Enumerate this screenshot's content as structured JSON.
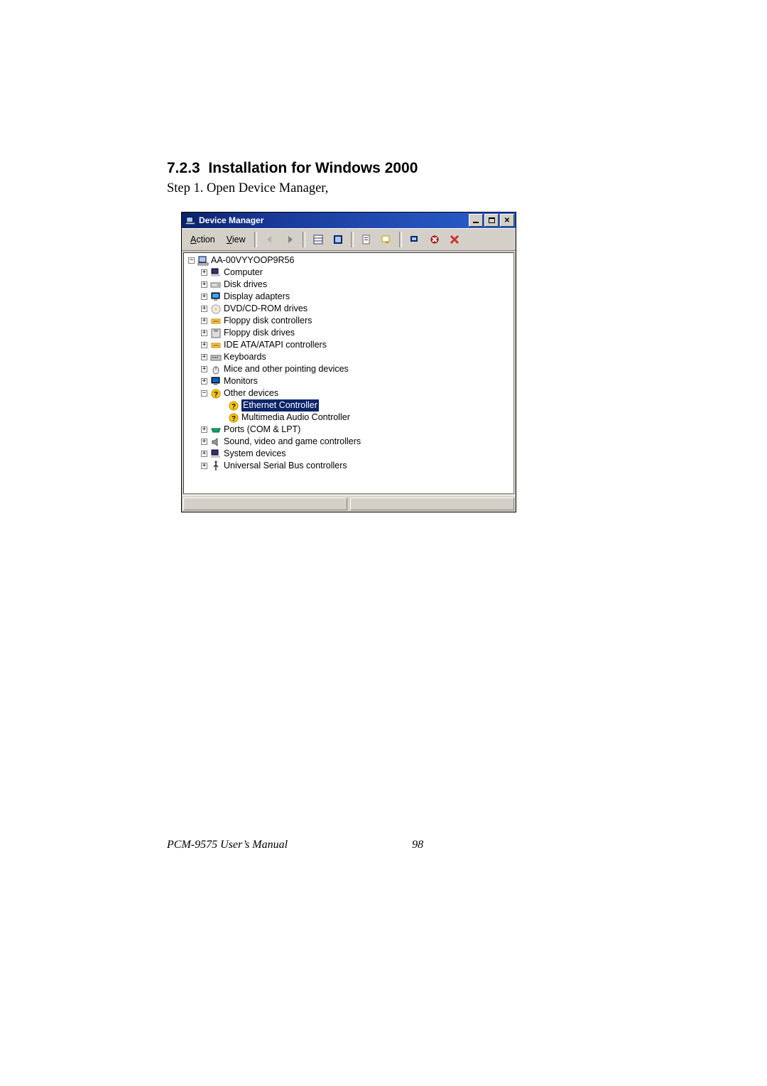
{
  "doc": {
    "heading_number": "7.2.3",
    "heading_text": "Installation for Windows 2000",
    "step_text": "Step 1.  Open Device Manager,"
  },
  "window": {
    "title": "Device Manager",
    "menu": {
      "action": "Action",
      "action_ul": "A",
      "view": "View",
      "view_ul": "V"
    },
    "toolbar_icons": {
      "back": "back-icon",
      "forward": "forward-icon",
      "up": "list-icon",
      "show": "show-hidden-icon",
      "properties": "properties-icon",
      "refresh": "refresh-icon",
      "remove": "remove-icon",
      "scan": "scan-hardware-icon",
      "cancel": "cancel-icon"
    },
    "tree": {
      "root": "AA-00VYYOOP9R56",
      "root_expander": "−",
      "children": [
        {
          "exp": "+",
          "label": "Computer",
          "icon": "computer-icon"
        },
        {
          "exp": "+",
          "label": "Disk drives",
          "icon": "disk-icon"
        },
        {
          "exp": "+",
          "label": "Display adapters",
          "icon": "display-icon"
        },
        {
          "exp": "+",
          "label": "DVD/CD-ROM drives",
          "icon": "cdrom-icon"
        },
        {
          "exp": "+",
          "label": "Floppy disk controllers",
          "icon": "controller-icon"
        },
        {
          "exp": "+",
          "label": "Floppy disk drives",
          "icon": "floppy-icon"
        },
        {
          "exp": "+",
          "label": "IDE ATA/ATAPI controllers",
          "icon": "controller-icon"
        },
        {
          "exp": "+",
          "label": "Keyboards",
          "icon": "keyboard-icon"
        },
        {
          "exp": "+",
          "label": "Mice and other pointing devices",
          "icon": "mouse-icon"
        },
        {
          "exp": "+",
          "label": "Monitors",
          "icon": "monitor-icon"
        },
        {
          "exp": "−",
          "label": "Other devices",
          "icon": "other-devices-icon",
          "children": [
            {
              "label": "Ethernet Controller",
              "icon": "unknown-device-icon",
              "selected": true
            },
            {
              "label": "Multimedia Audio Controller",
              "icon": "unknown-device-icon"
            }
          ]
        },
        {
          "exp": "+",
          "label": "Ports (COM & LPT)",
          "icon": "ports-icon"
        },
        {
          "exp": "+",
          "label": "Sound, video and game controllers",
          "icon": "sound-icon"
        },
        {
          "exp": "+",
          "label": "System devices",
          "icon": "system-icon"
        },
        {
          "exp": "+",
          "label": "Universal Serial Bus controllers",
          "icon": "usb-icon"
        }
      ]
    }
  },
  "footer": {
    "manual": "PCM-9575 User’s Manual",
    "page": "98"
  }
}
